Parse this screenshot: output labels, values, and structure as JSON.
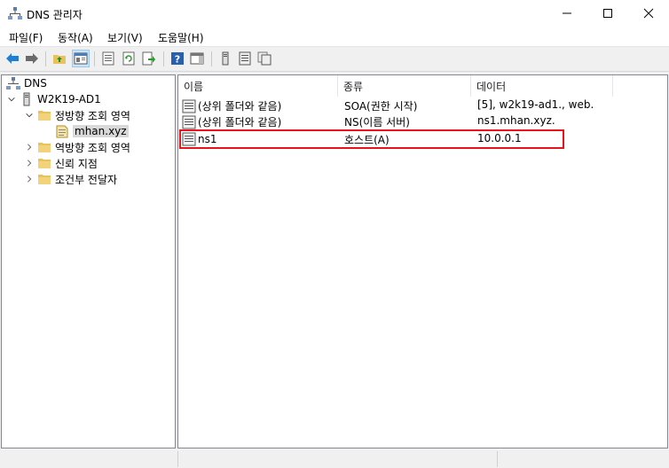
{
  "window": {
    "title": "DNS 관리자"
  },
  "menu": [
    {
      "label": "파일(F)"
    },
    {
      "label": "동작(A)"
    },
    {
      "label": "보기(V)"
    },
    {
      "label": "도움말(H)"
    }
  ],
  "tree": {
    "root": "DNS",
    "server": "W2K19-AD1",
    "forward_zones": "정방향 조회 영역",
    "zone": "mhan.xyz",
    "reverse_zones": "역방향 조회 영역",
    "trust_points": "신뢰 지점",
    "conditional_forwarders": "조건부 전달자"
  },
  "list": {
    "columns": [
      "이름",
      "종류",
      "데이터"
    ],
    "rows": [
      {
        "name": "(상위 폴더와 같음)",
        "type": "SOA(권한 시작)",
        "data": "[5], w2k19-ad1., web."
      },
      {
        "name": "(상위 폴더와 같음)",
        "type": "NS(이름 서버)",
        "data": "ns1.mhan.xyz."
      },
      {
        "name": "ns1",
        "type": "호스트(A)",
        "data": "10.0.0.1"
      }
    ]
  },
  "colors": {
    "highlight": "#e8141b",
    "selection": "#d9d9d9",
    "toolbar_active": "#cce4f7"
  }
}
